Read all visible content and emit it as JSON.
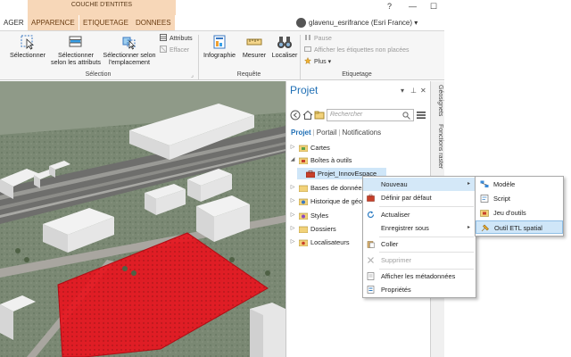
{
  "ribbon_header": {
    "context_tab_group": "COUCHE D'ENTITES",
    "help": "?",
    "minimize": "—",
    "maximize": "☐"
  },
  "tabs": [
    {
      "label": "AGER"
    },
    {
      "label": "APPARENCE"
    },
    {
      "label": "ETIQUETAGE"
    },
    {
      "label": "DONNEES"
    }
  ],
  "user": {
    "name": "glavenu_esrifrance (Esri France)",
    "dropdown": "▾"
  },
  "ribbon": {
    "selection_group": {
      "label": "Sélection",
      "buttons": {
        "select": "Sélectionner",
        "select_by_attr_l1": "Sélectionner",
        "select_by_attr_l2": "selon les attributs",
        "select_by_loc_l1": "Sélectionner selon",
        "select_by_loc_l2": "l'emplacement"
      },
      "small": {
        "attributes": "Attributs",
        "clear": "Effacer"
      }
    },
    "request_group": {
      "label": "Requête",
      "buttons": {
        "infographic": "Infographie",
        "measure": "Mesurer",
        "locate": "Localiser"
      }
    },
    "label_group": {
      "label": "Etiquetage",
      "pause": "Pause",
      "show_unplaced": "Afficher les étiquettes non placées",
      "more": "Plus"
    }
  },
  "pane": {
    "title": "Projet",
    "search_placeholder": "Rechercher",
    "subtabs": [
      "Projet",
      "Portail",
      "Notifications"
    ],
    "tree": [
      {
        "label": "Cartes",
        "expander": "▷"
      },
      {
        "label": "Boîtes à outils",
        "expander": "◢"
      },
      {
        "label": "Projet_InnovEspace",
        "expander": "",
        "selected": true
      },
      {
        "label": "Bases de données",
        "expander": "▷"
      },
      {
        "label": "Historique de géo",
        "expander": "▷"
      },
      {
        "label": "Styles",
        "expander": "▷"
      },
      {
        "label": "Dossiers",
        "expander": "▷"
      },
      {
        "label": "Localisateurs",
        "expander": "▷"
      }
    ]
  },
  "side_tabs": [
    "Géosignets",
    "Fonctions raster"
  ],
  "context_menu": {
    "items": [
      {
        "label": "Nouveau",
        "icon": "none",
        "has_submenu": true,
        "highlighted": true
      },
      {
        "label": "Définir par défaut",
        "icon": "toolbox-icon"
      },
      {
        "label": "Actualiser",
        "icon": "refresh-icon"
      },
      {
        "label": "Enregistrer sous",
        "icon": "none",
        "has_submenu": true
      },
      {
        "label": "Coller",
        "icon": "paste-icon"
      },
      {
        "label": "Supprimer",
        "icon": "delete-icon",
        "disabled": true
      },
      {
        "label": "Afficher les métadonnées",
        "icon": "metadata-icon"
      },
      {
        "label": "Propriétés",
        "icon": "properties-icon"
      }
    ],
    "arrow": "▸"
  },
  "submenu": {
    "items": [
      {
        "label": "Modèle",
        "icon": "model-icon"
      },
      {
        "label": "Script",
        "icon": "script-icon"
      },
      {
        "label": "Jeu d'outils",
        "icon": "toolset-icon"
      },
      {
        "label": "Outil ETL spatial",
        "icon": "etl-tool-icon",
        "highlighted": true
      }
    ]
  },
  "colors": {
    "context_tab_bg": "#f7d7b8",
    "pane_title": "#1f6fb5",
    "selection_bg": "#cfe6f8",
    "highlight_red": "#e8141e"
  }
}
